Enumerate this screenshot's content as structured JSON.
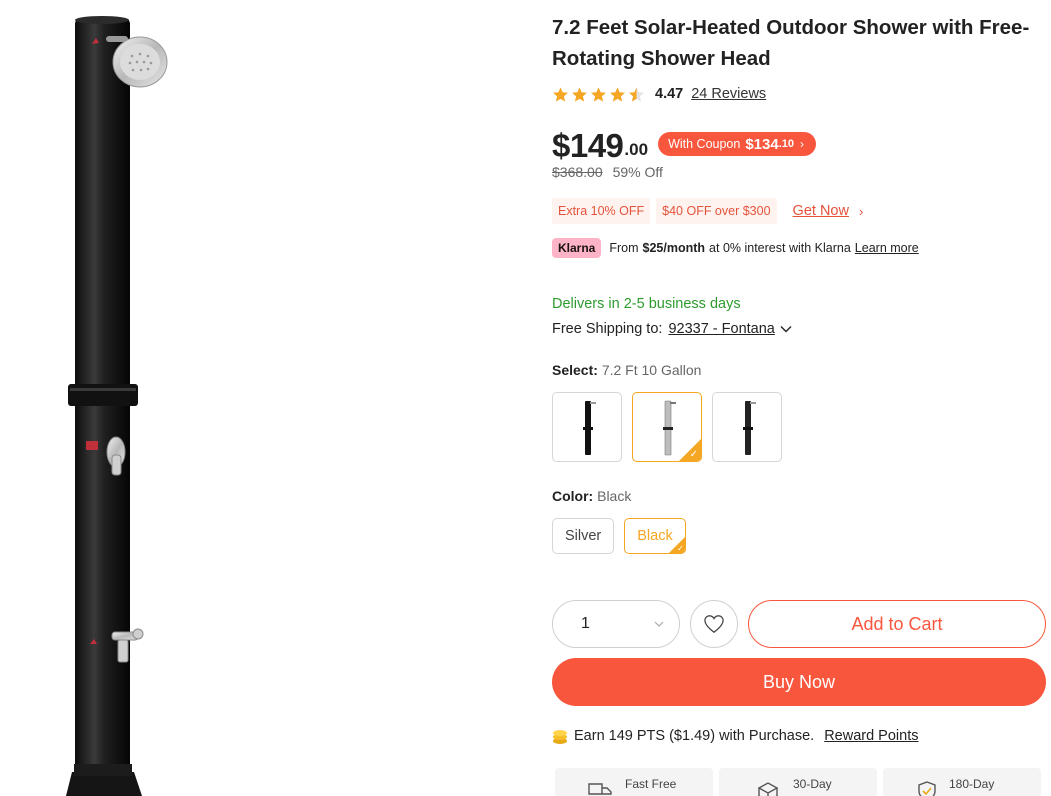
{
  "product": {
    "title": "7.2 Feet Solar-Heated Outdoor Shower with Free-Rotating Shower Head",
    "rating_value": "4.47",
    "rating_stars": 4.47,
    "reviews_label": "24 Reviews"
  },
  "price": {
    "main": "$149",
    "cents": ".00",
    "coupon_label": "With Coupon",
    "coupon_price": "$134",
    "coupon_cents": ".10",
    "coupon_arrow": "›",
    "old_price": "$368.00",
    "discount": "59% Off"
  },
  "promotions": {
    "tags": [
      "Extra 10% OFF",
      "$40 OFF over $300"
    ],
    "get_now_label": "Get Now",
    "get_now_arrow": "›"
  },
  "klarna": {
    "badge": "Klarna",
    "prefix": "From",
    "amount": "$25/month",
    "suffix": "at 0% interest with Klarna",
    "learn_more": "Learn more"
  },
  "shipping": {
    "delivery": "Delivers in 2-5 business days",
    "label": "Free Shipping to:",
    "location": "92337 - Fontana"
  },
  "options": {
    "select_label": "Select:",
    "select_value": "7.2 Ft 10 Gallon",
    "color_label": "Color:",
    "color_value": "Black",
    "colors": [
      "Silver",
      "Black"
    ],
    "selected_color": "Black"
  },
  "actions": {
    "quantity": "1",
    "add_to_cart": "Add to Cart",
    "buy_now": "Buy Now"
  },
  "points": {
    "text": "Earn 149 PTS ($1.49) with Purchase.",
    "link": "Reward Points"
  },
  "benefits": [
    "Fast Free",
    "30-Day",
    "180-Day"
  ],
  "colors": {
    "accent": "#f9573d",
    "selected": "#f5a623",
    "delivery_green": "#2e9b2e",
    "star": "#f5a623",
    "klarna_pink": "#ffb3c7"
  }
}
